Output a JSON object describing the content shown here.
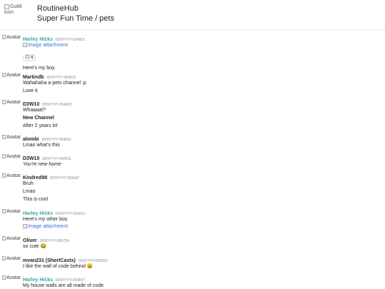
{
  "header": {
    "guild_icon_alt": "Guild icon",
    "guild_name": "RoutineHub",
    "channel_path": "Super Fun Time / pets"
  },
  "avatar_alt": "Avatar",
  "colors": {
    "highlight_author": "#3aa3a3",
    "link": "#3b6fd6"
  },
  "messages": [
    {
      "author": "Harley Hicks",
      "timestamp": "05!9YYYY-054803",
      "lines": [
        "Here's my boy."
      ],
      "attachment": "Image attachment",
      "reaction": {
        "icon": "image-icon",
        "count": "4"
      }
    },
    {
      "author": "Martindb",
      "timestamp": "05!9YYYY-054819",
      "lines": [
        "Wahahaha a pets channel :p",
        "Love it"
      ]
    },
    {
      "author": "D3W10",
      "timestamp": "05!9YYYY-054823",
      "lines": [
        "Whaaaat?",
        "New Channel",
        "After 2 years lol"
      ]
    },
    {
      "author": "alombi",
      "timestamp": "05!9YYYY-054853",
      "lines": [
        "Lmao what's this"
      ]
    },
    {
      "author": "D3W10",
      "timestamp": "05!9YYYY-054911",
      "lines": [
        "You're new home"
      ]
    },
    {
      "author": "Kindred98",
      "timestamp": "05!9YYYY-055547",
      "lines": [
        "Bruh",
        "Lmao",
        "This is cool"
      ]
    },
    {
      "author": "Harley Hicks",
      "timestamp": "05!9YYYY-055613",
      "lines": [
        "Here's my other boy"
      ],
      "attachment": "Image attachment"
    },
    {
      "author": "Oliver",
      "timestamp": "05!9YYYY-055724",
      "lines": [
        "so cute"
      ],
      "emoji": "😂"
    },
    {
      "author": "mvan231 (ShortCasts)",
      "timestamp": "05!9YYYY-055822",
      "lines": [
        "I like the wall of code behind"
      ],
      "emoji": "😄"
    },
    {
      "author": "Harley Hicks",
      "timestamp": "05!9YYYY-055847",
      "lines": [
        "My house walls are all made of code"
      ]
    }
  ]
}
